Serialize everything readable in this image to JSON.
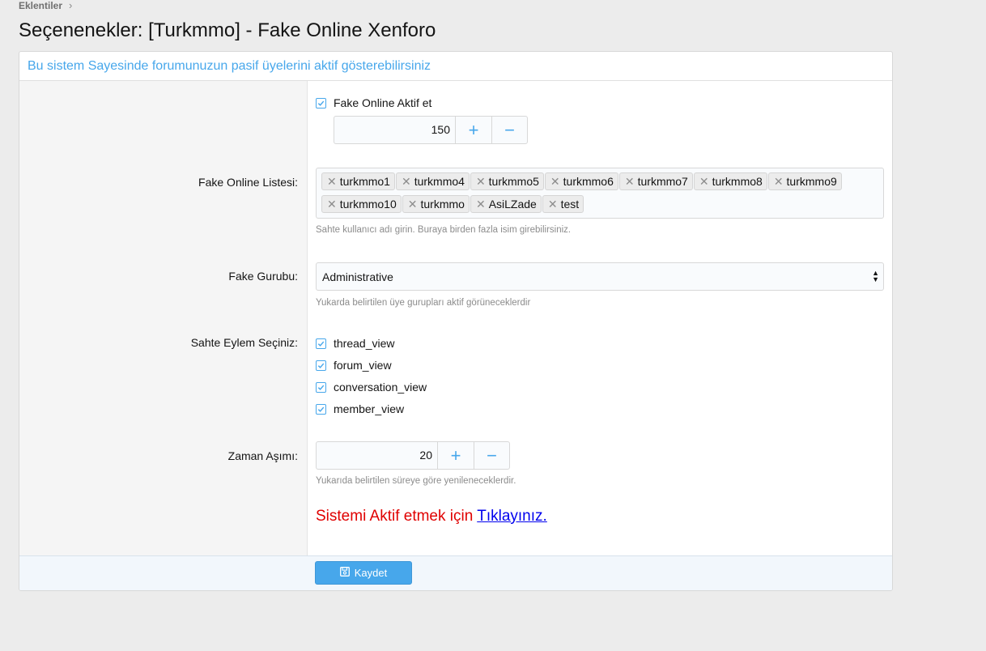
{
  "breadcrumb": {
    "item": "Eklentiler",
    "separator": "›"
  },
  "page": {
    "title": "Seçenenekler: [Turkmmo] - Fake Online Xenforo"
  },
  "block": {
    "header": "Bu sistem Sayesinde forumunuzun pasif üyelerini aktif gösterebilirsiniz"
  },
  "options": {
    "fake_online": {
      "checkbox_label": "Fake Online Aktif et",
      "checked": true,
      "value": "150",
      "plus": "+",
      "minus": "−"
    },
    "online_list": {
      "label": "Fake Online Listesi:",
      "tokens": [
        "turkmmo1",
        "turkmmo4",
        "turkmmo5",
        "turkmmo6",
        "turkmmo7",
        "turkmmo8",
        "turkmmo9",
        "turkmmo10",
        "turkmmo",
        "AsiLZade",
        "test"
      ],
      "remove_glyph": "✕",
      "hint": "Sahte kullanıcı adı girin. Buraya birden fazla isim girebilirsiniz."
    },
    "group": {
      "label": "Fake Gurubu:",
      "selected": "Administrative",
      "hint": "Yukarda belirtilen üye gurupları aktif görüneceklerdir"
    },
    "actions": {
      "label": "Sahte Eylem Seçiniz:",
      "items": [
        "thread_view",
        "forum_view",
        "conversation_view",
        "member_view"
      ]
    },
    "timeout": {
      "label": "Zaman Aşımı:",
      "value": "20",
      "plus": "+",
      "minus": "−",
      "hint": "Yukarıda belirtilen süreye göre yenileneceklerdir."
    },
    "activate": {
      "text": "Sistemi Aktif etmek için ",
      "link": "Tıklayınız."
    }
  },
  "footer": {
    "save_label": "Kaydet"
  },
  "colors": {
    "accent": "#47a7eb",
    "activate_text": "#e00000",
    "link": "#0000ee"
  }
}
